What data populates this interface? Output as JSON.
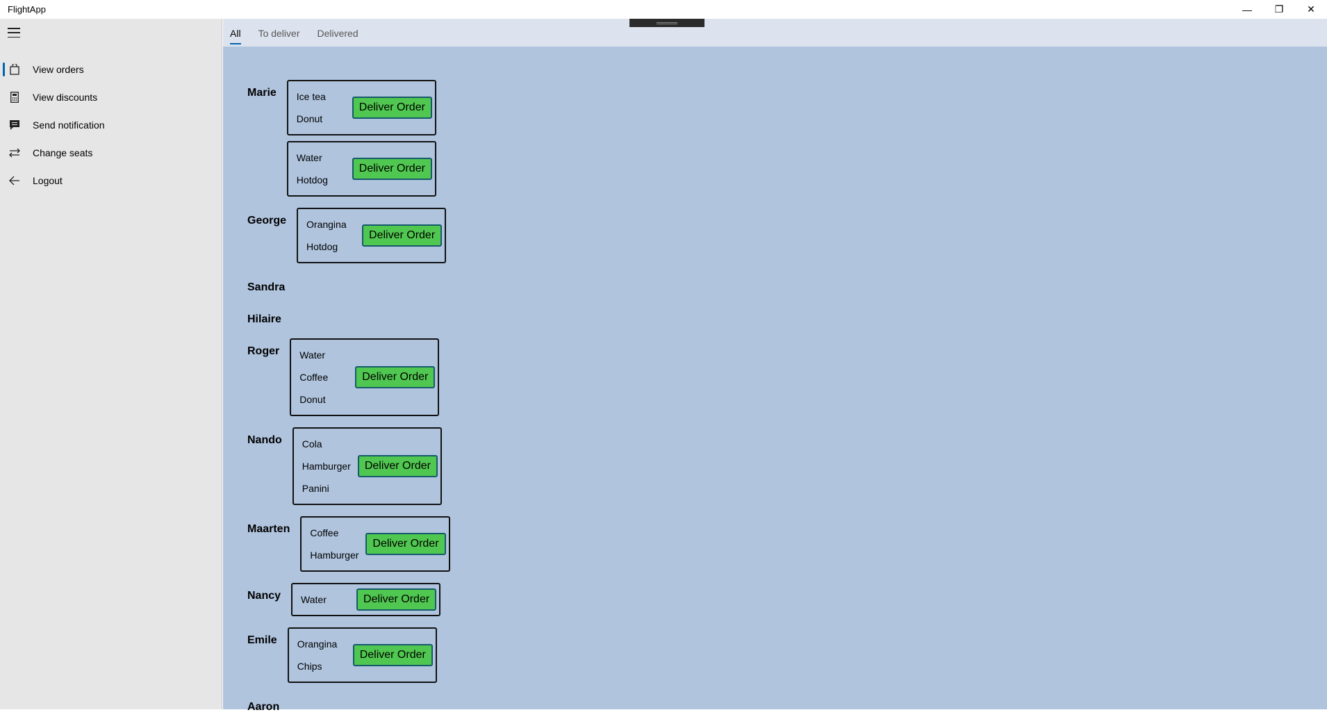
{
  "app": {
    "title": "FlightApp",
    "controls": {
      "minimize": "—",
      "restore": "❐",
      "close": "✕"
    }
  },
  "sidebar": {
    "items": [
      {
        "label": "View orders",
        "icon": "bag-icon",
        "selected": true
      },
      {
        "label": "View discounts",
        "icon": "calculator-icon",
        "selected": false
      },
      {
        "label": "Send notification",
        "icon": "message-icon",
        "selected": false
      },
      {
        "label": "Change seats",
        "icon": "swap-icon",
        "selected": false
      },
      {
        "label": "Logout",
        "icon": "back-arrow-icon",
        "selected": false
      }
    ]
  },
  "tabs": [
    {
      "label": "All",
      "active": true
    },
    {
      "label": "To deliver",
      "active": false
    },
    {
      "label": "Delivered",
      "active": false
    }
  ],
  "deliver_label": "Deliver Order",
  "colors": {
    "content_bg": "#b0c4de",
    "sidebar_bg": "#e6e6e6",
    "button_bg": "#50c750",
    "accent": "#0063b1"
  },
  "passengers": [
    {
      "name": "Marie",
      "orders": [
        [
          "Ice tea",
          "Donut"
        ],
        [
          "Water",
          "Hotdog"
        ]
      ]
    },
    {
      "name": "George",
      "orders": [
        [
          "Orangina",
          "Hotdog"
        ]
      ]
    },
    {
      "name": "Sandra",
      "orders": []
    },
    {
      "name": "Hilaire",
      "orders": []
    },
    {
      "name": "Roger",
      "orders": [
        [
          "Water",
          "Coffee",
          "Donut"
        ]
      ]
    },
    {
      "name": "Nando",
      "orders": [
        [
          "Cola",
          "Hamburger",
          "Panini"
        ]
      ]
    },
    {
      "name": "Maarten",
      "orders": [
        [
          "Coffee",
          "Hamburger"
        ]
      ]
    },
    {
      "name": "Nancy",
      "orders": [
        [
          "Water"
        ]
      ]
    },
    {
      "name": "Emile",
      "orders": [
        [
          "Orangina",
          "Chips"
        ]
      ]
    },
    {
      "name": "Aaron",
      "orders": []
    }
  ]
}
